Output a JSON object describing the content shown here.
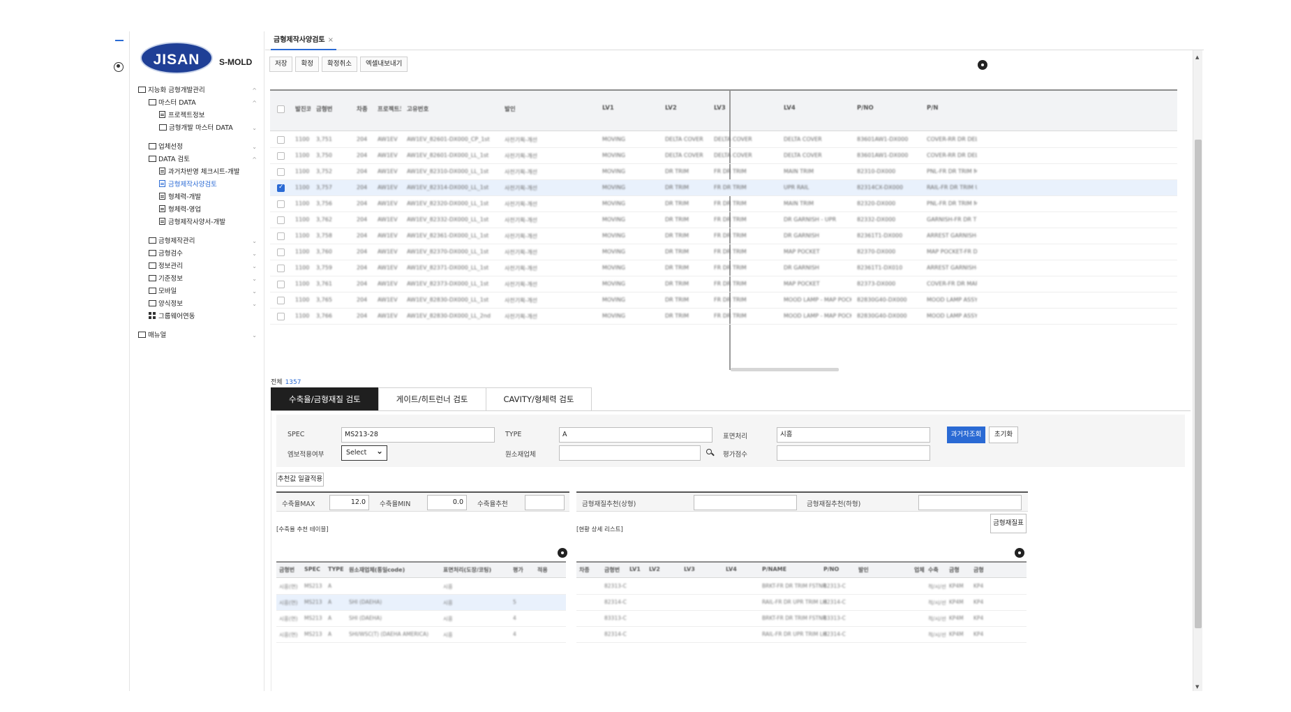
{
  "rail": {
    "user_icon": "user-circle-icon"
  },
  "brand": {
    "logo_text": "JISAN",
    "product": "S-MOLD"
  },
  "menu": [
    {
      "label": "지능화 금형개발관리",
      "level": 1,
      "type": "folder",
      "chevron": "^"
    },
    {
      "label": "마스터 DATA",
      "level": 2,
      "type": "folder",
      "chevron": "^"
    },
    {
      "label": "프로젝트정보",
      "level": 3,
      "type": "doc"
    },
    {
      "label": "금형개발 마스터 DATA",
      "level": 3,
      "type": "folder",
      "chevron": "⌄"
    },
    {
      "gap": true
    },
    {
      "label": "업체선정",
      "level": 2,
      "type": "folder",
      "chevron": "⌄"
    },
    {
      "label": "DATA 검토",
      "level": 2,
      "type": "folder",
      "chevron": "^"
    },
    {
      "label": "과거차반영 체크시트-개발",
      "level": 3,
      "type": "doc"
    },
    {
      "label": "금형제작사양검토",
      "level": 3,
      "type": "doc",
      "active": true
    },
    {
      "label": "형체력-개발",
      "level": 3,
      "type": "doc"
    },
    {
      "label": "형체력-영업",
      "level": 3,
      "type": "doc"
    },
    {
      "label": "금형제작사양서-개발",
      "level": 3,
      "type": "doc"
    },
    {
      "gap": true
    },
    {
      "label": "금형제작관리",
      "level": 2,
      "type": "folder",
      "chevron": "⌄"
    },
    {
      "label": "금형검수",
      "level": 2,
      "type": "folder",
      "chevron": "⌄"
    },
    {
      "label": "정보관리",
      "level": 2,
      "type": "folder",
      "chevron": "⌄"
    },
    {
      "label": "기준정보",
      "level": 2,
      "type": "folder",
      "chevron": "⌄"
    },
    {
      "label": "모바일",
      "level": 2,
      "type": "folder",
      "chevron": "⌄"
    },
    {
      "label": "양식정보",
      "level": 2,
      "type": "folder",
      "chevron": "⌄"
    },
    {
      "label": "그룹웨어연동",
      "level": 2,
      "type": "grid"
    },
    {
      "gap": true
    },
    {
      "label": "매뉴얼",
      "level": 1,
      "type": "folder",
      "chevron": "⌄"
    }
  ],
  "tab": {
    "label": "금형제작사양검토",
    "close": "×"
  },
  "toolbar": {
    "save": "저장",
    "confirm": "확정",
    "cancel_confirm": "확정취소",
    "excel": "엑셀내보내기"
  },
  "grid": {
    "headers": [
      "발진코드(품번)",
      "금형번",
      "차종",
      "프로젝트코드",
      "고유번호",
      "발인",
      "LV1",
      "LV2",
      "LV3",
      "LV4",
      "P/NO",
      "P/N"
    ],
    "rows": [
      [
        "1100",
        "3,751",
        "204",
        "AW1EV",
        "AW1EV_82601-DX000_CP_1st",
        "사전기획-개선",
        "MOVING",
        "DELTA COVER",
        "DELTA COVER",
        "DELTA COVER",
        "83601AW1-DX000",
        "COVER-RR DR DELT"
      ],
      [
        "1100",
        "3,750",
        "204",
        "AW1EV",
        "AW1EV_82601-DX000_LL_1st",
        "사전기획-개선",
        "MOVING",
        "DELTA COVER",
        "DELTA COVER",
        "DELTA COVER",
        "83601AW1-DX000",
        "COVER-RR DR DELT"
      ],
      [
        "1100",
        "3,752",
        "204",
        "AW1EV",
        "AW1EV_82310-DX000_LL_1st",
        "사전기획-개선",
        "MOVING",
        "DR TRIM",
        "FR DR TRIM",
        "MAIN TRIM",
        "82310-DX000",
        "PNL-FR DR TRIM MA"
      ],
      [
        "1100",
        "3,757",
        "204",
        "AW1EV",
        "AW1EV_82314-DX000_LL_1st",
        "사전기획-개선",
        "MOVING",
        "DR TRIM",
        "FR DR TRIM",
        "UPR RAIL",
        "82314CX-DX000",
        "RAIL-FR DR TRIM UP"
      ],
      [
        "1100",
        "3,756",
        "204",
        "AW1EV",
        "AW1EV_82320-DX000_LL_1st",
        "사전기획-개선",
        "MOVING",
        "DR TRIM",
        "FR DR TRIM",
        "MAIN TRIM",
        "82320-DX000",
        "PNL-FR DR TRIM MA"
      ],
      [
        "1100",
        "3,762",
        "204",
        "AW1EV",
        "AW1EV_82332-DX000_LL_1st",
        "사전기획-개선",
        "MOVING",
        "DR TRIM",
        "FR DR TRIM",
        "DR GARNISH - UPR",
        "82332-DX000",
        "GARNISH-FR DR TR"
      ],
      [
        "1100",
        "3,758",
        "204",
        "AW1EV",
        "AW1EV_82361-DX000_LL_1st",
        "사전기획-개선",
        "MOVING",
        "DR TRIM",
        "FR DR TRIM",
        "DR GARNISH",
        "82361T1-DX000",
        "ARREST GARNISH-F"
      ],
      [
        "1100",
        "3,760",
        "204",
        "AW1EV",
        "AW1EV_82370-DX000_LL_1st",
        "사전기획-개선",
        "MOVING",
        "DR TRIM",
        "FR DR TRIM",
        "MAP POCKET",
        "82370-DX000",
        "MAP POCKET-FR D"
      ],
      [
        "1100",
        "3,759",
        "204",
        "AW1EV",
        "AW1EV_82371-DX000_LL_1st",
        "사전기획-개선",
        "MOVING",
        "DR TRIM",
        "FR DR TRIM",
        "DR GARNISH",
        "82361T1-DX010",
        "ARREST GARNISH-F"
      ],
      [
        "1100",
        "3,761",
        "204",
        "AW1EV",
        "AW1EV_82373-DX000_LL_1st",
        "사전기획-개선",
        "MOVING",
        "DR TRIM",
        "FR DR TRIM",
        "MAP POCKET",
        "82373-DX000",
        "COVER-FR DR MAP"
      ],
      [
        "1100",
        "3,765",
        "204",
        "AW1EV",
        "AW1EV_82830-DX000_LL_1st",
        "사전기획-개선",
        "MOVING",
        "DR TRIM",
        "FR DR TRIM",
        "MOOD LAMP - MAP POCKET",
        "82830G40-DX000",
        "MOOD LAMP ASSY"
      ],
      [
        "1100",
        "3,766",
        "204",
        "AW1EV",
        "AW1EV_82830-DX000_LL_2nd",
        "사전기획-개선",
        "MOVING",
        "DR TRIM",
        "FR DR TRIM",
        "MOOD LAMP - MAP POCKET",
        "82830G40-DX000",
        "MOOD LAMP ASSY"
      ]
    ],
    "selected_row": 3
  },
  "total": {
    "label": "전체",
    "count": "1357"
  },
  "subtabs": [
    "수축율/금형재질 검토",
    "게이트/히트런너 검토",
    "CAVITY/형체력 검토"
  ],
  "form": {
    "spec_label": "SPEC",
    "spec_value": "MS213-28",
    "type_label": "TYPE",
    "type_value": "A",
    "surface_label": "표면처리",
    "surface_value": "시흥",
    "emboss_label": "엠보적용여부",
    "emboss_value": "Select",
    "raw_label": "원소재업체",
    "raw_value": "",
    "score_label": "평가점수",
    "score_value": "",
    "past_button": "과거차조회",
    "reset_button": "초기화",
    "apply_button": "추천값 일괄적용"
  },
  "shrink": {
    "max_label": "수축율MAX",
    "max_value": "12.0",
    "min_label": "수축율MIN",
    "min_value": "0.0",
    "rec_label": "수축율추천",
    "rec_value": ""
  },
  "material": {
    "upper_label": "금형재질추천(상형)",
    "upper_value": "",
    "lower_label": "금형재질추천(하형)",
    "lower_value": "",
    "table_button": "금형재질표"
  },
  "left_table": {
    "caption": "[수축율 추천 테이블]",
    "headers": [
      "금형번",
      "SPEC",
      "TYPE",
      "원소재업체(통일code)",
      "표면처리(도장/코팅)",
      "평가",
      "적용"
    ],
    "rows": [
      [
        "시흥(연)",
        "MS213",
        "A",
        "",
        "시흥",
        "",
        ""
      ],
      [
        "시흥(연)",
        "MS213",
        "A",
        "SHI (DAEHA)",
        "시흥",
        "5",
        ""
      ],
      [
        "시흥(연)",
        "MS213",
        "A",
        "SHI (DAEHA)",
        "시흥",
        "4",
        ""
      ],
      [
        "시흥(연)",
        "MS213",
        "A",
        "SHI/WSC(T) (DAEHA AMERICA)",
        "시흥",
        "4",
        ""
      ]
    ],
    "selected_row": 1
  },
  "right_table": {
    "caption": "[현황 상세 리스트]",
    "headers": [
      "차종",
      "금형번",
      "LV1",
      "LV2",
      "LV3",
      "LV4",
      "P/NAME",
      "P/NO",
      "발인",
      "업체",
      "수축",
      "금형",
      "금형"
    ],
    "rows": [
      [
        "",
        "82313-C",
        "",
        "",
        "",
        "",
        "BRKT-FR DR TRIM FSTNR",
        "82313-C",
        "",
        "",
        "적/시/선",
        "KP4M",
        "KP4"
      ],
      [
        "",
        "82314-C",
        "",
        "",
        "",
        "",
        "RAIL-FR DR UPR TRIM LH",
        "82314-C",
        "",
        "",
        "적/시/선",
        "KP4M",
        "KP4"
      ],
      [
        "",
        "83313-C",
        "",
        "",
        "",
        "",
        "BRKT-FR DR TRIM FSTNR",
        "83313-C",
        "",
        "",
        "적/시/선",
        "KP4M",
        "KP4"
      ],
      [
        "",
        "82314-C",
        "",
        "",
        "",
        "",
        "RAIL-FR DR UPR TRIM LH",
        "82314-C",
        "",
        "",
        "적/시/선",
        "KP4M",
        "KP4"
      ]
    ]
  },
  "icons": {
    "settings": "gear-icon",
    "search": "search-icon",
    "close": "close-icon"
  },
  "colors": {
    "accent": "#2a6ad4",
    "logo": "#1f3f96",
    "active_tab": "#1f1f1f",
    "selected_row": "#e9f1fc"
  }
}
